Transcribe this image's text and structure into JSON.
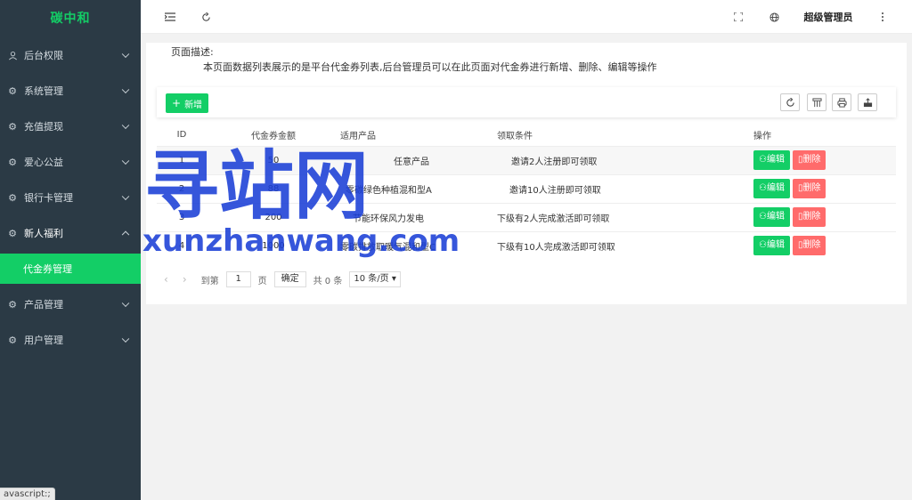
{
  "app": {
    "logo": "碳中和",
    "status_tip": "avascript:;"
  },
  "sidebar": {
    "items": [
      {
        "label": "后台权限",
        "icon": "user-icon"
      },
      {
        "label": "系统管理",
        "icon": "gear-icon"
      },
      {
        "label": "充值提现",
        "icon": "gear-icon"
      },
      {
        "label": "爱心公益",
        "icon": "gear-icon"
      },
      {
        "label": "银行卡管理",
        "icon": "gear-icon"
      },
      {
        "label": "新人福利",
        "icon": "gear-icon"
      },
      {
        "label": "产品管理",
        "icon": "gear-icon"
      },
      {
        "label": "用户管理",
        "icon": "gear-icon"
      }
    ],
    "active_sub": "代金券管理"
  },
  "header": {
    "user": "超级管理员"
  },
  "page": {
    "desc_title": "页面描述:",
    "desc_text": "本页面数据列表展示的是平台代金券列表,后台管理员可以在此页面对代金券进行新增、删除、编辑等操作"
  },
  "toolbar": {
    "add_label": "新增",
    "tools": [
      "refresh-icon",
      "columns-icon",
      "print-icon",
      "export-icon"
    ]
  },
  "table": {
    "headers": [
      "ID",
      "代金券金额",
      "适用产品",
      "领取条件",
      "操作"
    ],
    "rows": [
      {
        "id": "1",
        "amount": "50",
        "product": "任意产品",
        "condition": "邀请2人注册即可领取"
      },
      {
        "id": "2",
        "amount": "88",
        "product": "零碳绿色种植混和型A",
        "condition": "邀请10人注册即可领取"
      },
      {
        "id": "3",
        "amount": "200",
        "product": "节能环保风力发电",
        "condition": "下级有2人完成激活即可领取"
      },
      {
        "id": "4",
        "amount": "1000",
        "product": "零碳排放取暖气混和型C",
        "condition": "下级有10人完成激活即可领取"
      }
    ],
    "edit_label": "编辑",
    "delete_label": "删除"
  },
  "pagination": {
    "goto_label": "到第",
    "page_value": "1",
    "page_unit": "页",
    "confirm_label": "确定",
    "total_text": "共 0 条",
    "page_size": "10 条/页"
  },
  "watermark": {
    "title": "寻站网",
    "url": "xunzhanwang.com",
    "color": "#1a3fd6"
  }
}
